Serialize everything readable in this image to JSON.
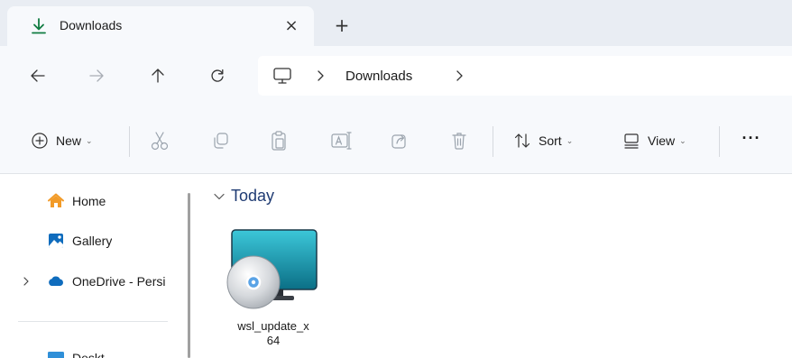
{
  "tab": {
    "title": "Downloads",
    "close_glyph": "×",
    "new_tab_glyph": "+",
    "icon": "download-icon"
  },
  "address": {
    "segment": "Downloads",
    "icon": "this-pc-icon"
  },
  "toolbar": {
    "new_label": "New",
    "sort_label": "Sort",
    "view_label": "View",
    "caret": "⌄",
    "more": "···"
  },
  "sidebar": {
    "items": [
      {
        "label": "Home",
        "icon": "home-icon"
      },
      {
        "label": "Gallery",
        "icon": "gallery-icon"
      },
      {
        "label": "OneDrive - Persi",
        "icon": "onedrive-cloud-icon"
      },
      {
        "label": "Deskt",
        "icon": "desktop-icon"
      }
    ]
  },
  "content": {
    "group_label": "Today",
    "files": [
      {
        "name_line1": "wsl_update_x",
        "name_line2": "64",
        "icon": "installer-package-icon"
      }
    ]
  },
  "colors": {
    "accent_green": "#107c41",
    "group_header": "#1f3b73",
    "onedrive_blue": "#0f6cbd",
    "home_orange": "#f29b28"
  }
}
